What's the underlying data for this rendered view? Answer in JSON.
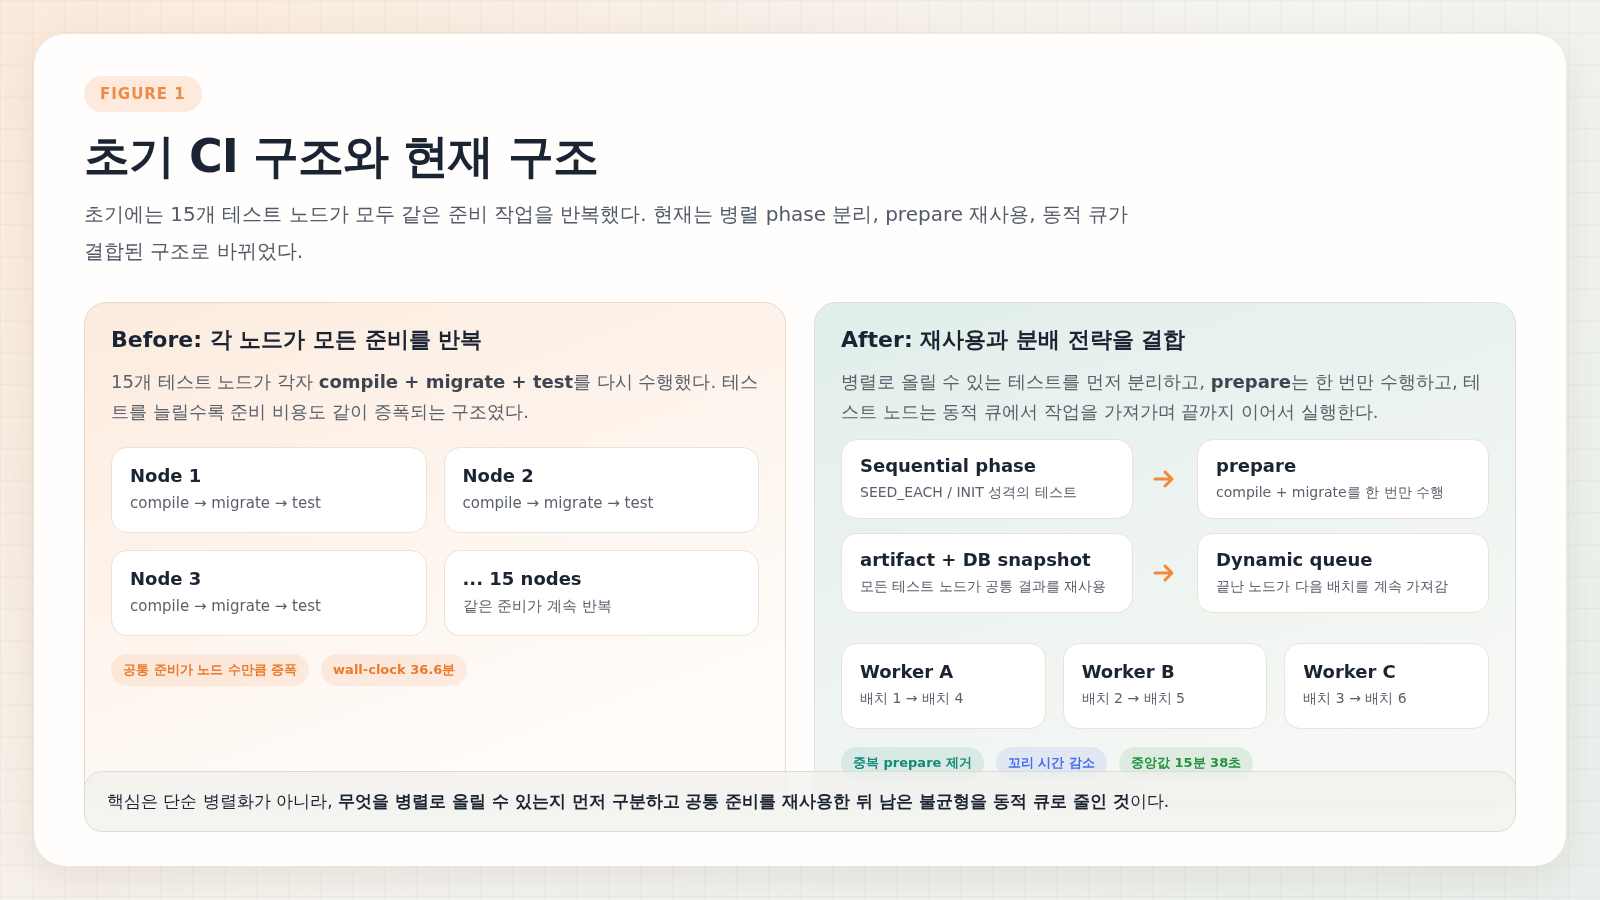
{
  "badge": "FIGURE 1",
  "title": "초기 CI 구조와 현재 구조",
  "subtitle": "초기에는 15개 테스트 노드가 모두 같은 준비 작업을 반복했다. 현재는 병렬 phase 분리, prepare 재사용, 동적 큐가 결합된 구조로 바뀌었다.",
  "panels": [
    {
      "kind": "before",
      "title": "Before: 각 노드가 모든 준비를 반복",
      "description": "15개 테스트 노드가 각자 **compile + migrate + test**를 다시 수행했다. 테스트를 늘릴수록 준비 비용도 같이 증폭되는 구조였다.",
      "nodes": [
        {
          "title": "Node 1",
          "detail": "compile → migrate → test"
        },
        {
          "title": "Node 2",
          "detail": "compile → migrate → test"
        },
        {
          "title": "Node 3",
          "detail": "compile → migrate → test"
        },
        {
          "title": "... 15 nodes",
          "detail": "같은 준비가 계속 반복"
        }
      ],
      "tags": [
        {
          "label": "공통 준비가 노드 수만큼 증폭",
          "color": "#ea7a2c"
        },
        {
          "label": "wall-clock 36.6분",
          "color": "#ea7a2c"
        }
      ]
    },
    {
      "kind": "after",
      "title": "After: 재사용과 분배 전략을 결합",
      "description": "병렬로 올릴 수 있는 테스트를 먼저 분리하고, **prepare**는 한 번만 수행하고, 테스트 노드는 동적 큐에서 작업을 가져가며 끝까지 이어서 실행한다.",
      "flow_rows": [
        [
          {
            "title": "Sequential phase",
            "detail": "SEED_EACH / INIT 성격의 테스트"
          },
          {
            "title": "prepare",
            "detail": "compile + migrate를 한 번만 수행"
          }
        ],
        [
          {
            "title": "artifact + DB snapshot",
            "detail": "모든 테스트 노드가 공통 결과를 재사용"
          },
          {
            "title": "Dynamic queue",
            "detail": "끝난 노드가 다음 배치를 계속 가져감"
          }
        ]
      ],
      "workers": [
        {
          "title": "Worker A",
          "detail": "배치 1 → 배치 4"
        },
        {
          "title": "Worker B",
          "detail": "배치 2 → 배치 5"
        },
        {
          "title": "Worker C",
          "detail": "배치 3 → 배치 6"
        }
      ],
      "tags": [
        {
          "label": "중복 prepare 제거",
          "color": "#138a7a"
        },
        {
          "label": "꼬리 시간 감소",
          "color": "#4a6cf0"
        },
        {
          "label": "중앙값 15분 38초",
          "color": "#23933f"
        }
      ]
    }
  ],
  "note": "핵심은 단순 병렬화가 아니라, **무엇을 병렬로 올릴 수 있는지 먼저 구분하고 공통 준비를 재사용한 뒤 남은 불균형을 동적 큐로 줄인 것**이다."
}
